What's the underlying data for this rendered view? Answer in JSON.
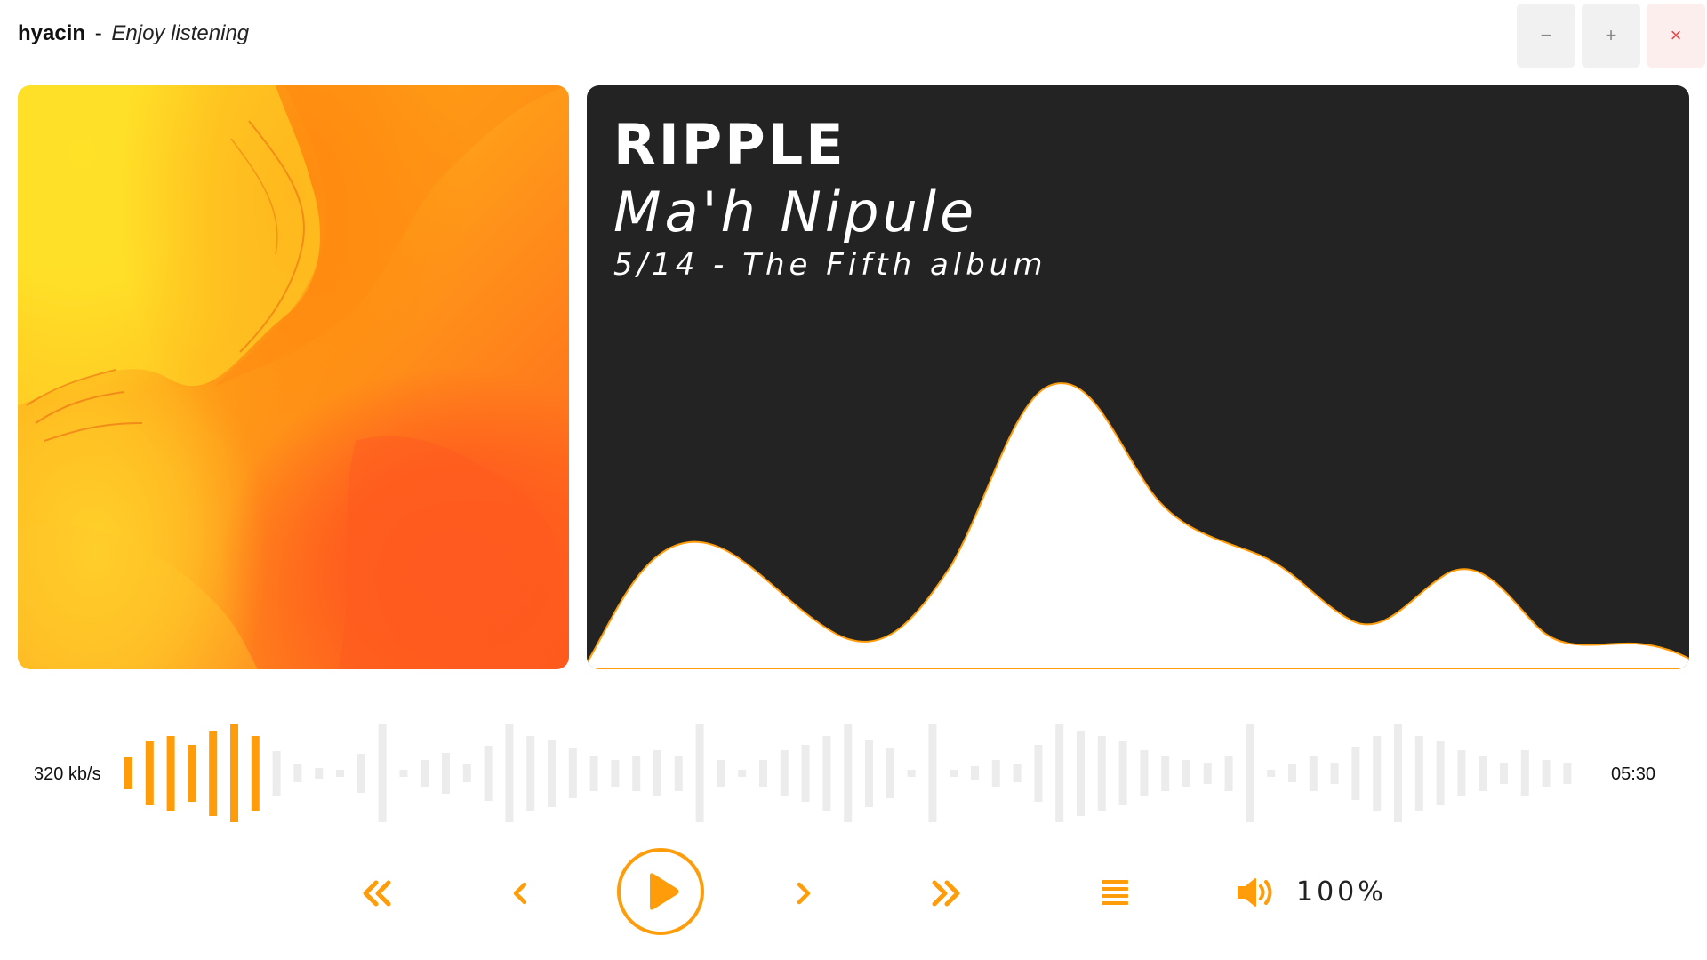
{
  "window": {
    "app_name": "hyacin",
    "separator": "-",
    "tagline": "Enjoy listening",
    "minimize_label": "−",
    "maximize_label": "+",
    "close_label": "×"
  },
  "track": {
    "title": "RIPPLE",
    "artist": "Ma'h Nipule",
    "album_line": "5/14 - The Fifth album"
  },
  "playback": {
    "bitrate": "320 kb/s",
    "duration": "05:30",
    "progress_bars_played": 7,
    "progress_bars_total": 70,
    "volume_label": "100%"
  },
  "controls": {
    "icons": [
      "skip-to-start-icon",
      "previous-icon",
      "play-icon",
      "next-icon",
      "skip-to-end-icon",
      "playlist-icon",
      "volume-icon"
    ]
  },
  "colors": {
    "accent": "#ff9c0a",
    "panel_background": "#232323",
    "waveform_inactive": "#ececec",
    "close_button_color": "#e44444"
  }
}
